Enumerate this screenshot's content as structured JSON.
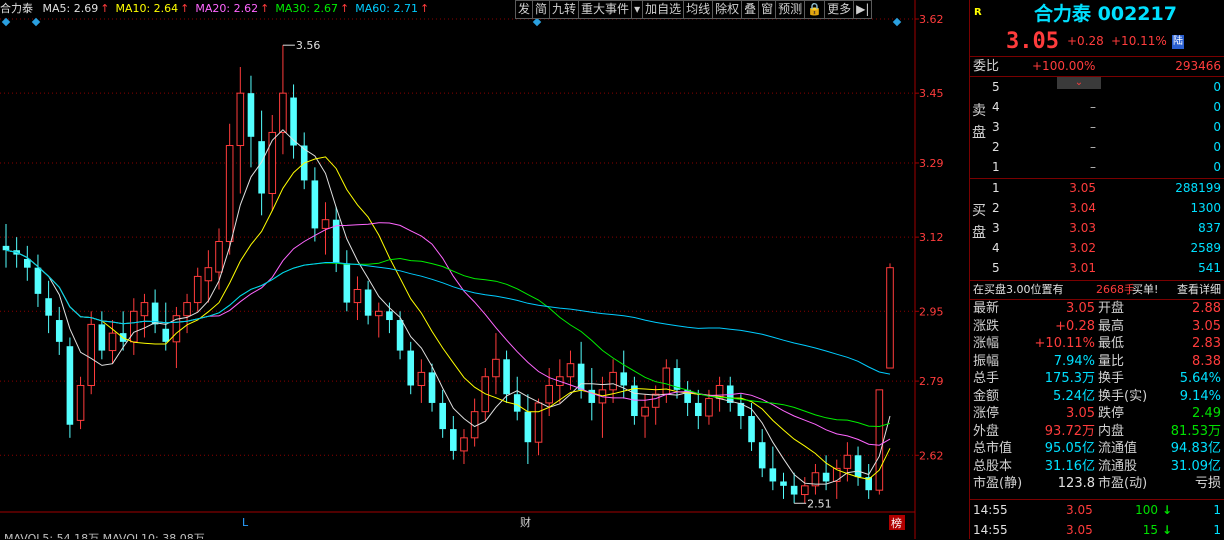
{
  "chart_title": "合力泰",
  "ma_legend": [
    {
      "label": "MA5: 2.69",
      "arrow": "↑",
      "color": "#e0e0e0"
    },
    {
      "label": "MA10: 2.64",
      "arrow": "↑",
      "color": "#ffff00"
    },
    {
      "label": "MA20: 2.62",
      "arrow": "↑",
      "color": "#ff66ff"
    },
    {
      "label": "MA30: 2.67",
      "arrow": "↑",
      "color": "#00ee00"
    },
    {
      "label": "MA60: 2.71",
      "arrow": "↑",
      "color": "#00ccff"
    }
  ],
  "toolbar": [
    "发",
    "简",
    "九转",
    "重大事件",
    "▾",
    "加自选",
    "均线",
    "除权",
    "叠",
    "窗",
    "预测",
    "🔒",
    "更多",
    "▶|"
  ],
  "bottom_markers": {
    "l": "L",
    "cai": "财",
    "bang": "榜"
  },
  "bottom_strip": "MAVOL5: 54.18万   MAVOL10: 38.08万",
  "chart_data": {
    "type": "candlestick",
    "y_ticks": [
      "3.62",
      "3.45",
      "3.29",
      "3.12",
      "2.95",
      "2.79",
      "2.62"
    ],
    "y_range": [
      2.49,
      3.62
    ],
    "annotations": {
      "high": "3.56",
      "low": "2.51"
    },
    "candles": [
      [
        3.1,
        3.15,
        3.05,
        3.09
      ],
      [
        3.09,
        3.12,
        3.05,
        3.08
      ],
      [
        3.07,
        3.1,
        3.02,
        3.05
      ],
      [
        3.05,
        3.08,
        2.96,
        2.99
      ],
      [
        2.98,
        3.02,
        2.9,
        2.94
      ],
      [
        2.93,
        2.96,
        2.85,
        2.88
      ],
      [
        2.87,
        2.89,
        2.66,
        2.69
      ],
      [
        2.7,
        2.8,
        2.68,
        2.78
      ],
      [
        2.78,
        2.95,
        2.76,
        2.92
      ],
      [
        2.92,
        2.95,
        2.84,
        2.86
      ],
      [
        2.86,
        2.93,
        2.83,
        2.9
      ],
      [
        2.9,
        2.95,
        2.86,
        2.88
      ],
      [
        2.88,
        2.98,
        2.85,
        2.95
      ],
      [
        2.94,
        2.99,
        2.89,
        2.97
      ],
      [
        2.97,
        3.0,
        2.9,
        2.92
      ],
      [
        2.91,
        2.97,
        2.86,
        2.88
      ],
      [
        2.88,
        2.96,
        2.82,
        2.94
      ],
      [
        2.94,
        2.99,
        2.9,
        2.97
      ],
      [
        2.97,
        3.05,
        2.95,
        3.03
      ],
      [
        3.02,
        3.09,
        2.97,
        3.05
      ],
      [
        3.04,
        3.14,
        3.0,
        3.11
      ],
      [
        3.11,
        3.38,
        3.08,
        3.33
      ],
      [
        3.33,
        3.51,
        3.22,
        3.45
      ],
      [
        3.45,
        3.49,
        3.28,
        3.35
      ],
      [
        3.34,
        3.41,
        3.17,
        3.22
      ],
      [
        3.22,
        3.4,
        3.18,
        3.36
      ],
      [
        3.36,
        3.56,
        3.31,
        3.45
      ],
      [
        3.44,
        3.47,
        3.3,
        3.33
      ],
      [
        3.33,
        3.36,
        3.23,
        3.25
      ],
      [
        3.25,
        3.28,
        3.11,
        3.14
      ],
      [
        3.14,
        3.2,
        3.08,
        3.16
      ],
      [
        3.16,
        3.19,
        3.04,
        3.06
      ],
      [
        3.06,
        3.09,
        2.95,
        2.97
      ],
      [
        2.97,
        3.03,
        2.93,
        3.0
      ],
      [
        3.0,
        3.02,
        2.92,
        2.94
      ],
      [
        2.94,
        2.97,
        2.89,
        2.95
      ],
      [
        2.95,
        2.97,
        2.9,
        2.93
      ],
      [
        2.93,
        2.95,
        2.84,
        2.86
      ],
      [
        2.86,
        2.88,
        2.76,
        2.78
      ],
      [
        2.78,
        2.84,
        2.74,
        2.81
      ],
      [
        2.81,
        2.83,
        2.72,
        2.74
      ],
      [
        2.74,
        2.77,
        2.66,
        2.68
      ],
      [
        2.68,
        2.71,
        2.61,
        2.63
      ],
      [
        2.63,
        2.68,
        2.6,
        2.66
      ],
      [
        2.66,
        2.75,
        2.64,
        2.72
      ],
      [
        2.72,
        2.82,
        2.7,
        2.8
      ],
      [
        2.8,
        2.9,
        2.76,
        2.84
      ],
      [
        2.84,
        2.86,
        2.74,
        2.76
      ],
      [
        2.76,
        2.8,
        2.7,
        2.72
      ],
      [
        2.72,
        2.76,
        2.6,
        2.65
      ],
      [
        2.65,
        2.75,
        2.62,
        2.74
      ],
      [
        2.74,
        2.82,
        2.71,
        2.78
      ],
      [
        2.78,
        2.84,
        2.74,
        2.8
      ],
      [
        2.8,
        2.86,
        2.77,
        2.83
      ],
      [
        2.83,
        2.88,
        2.75,
        2.77
      ],
      [
        2.77,
        2.82,
        2.7,
        2.74
      ],
      [
        2.74,
        2.8,
        2.66,
        2.77
      ],
      [
        2.77,
        2.84,
        2.74,
        2.81
      ],
      [
        2.81,
        2.86,
        2.75,
        2.78
      ],
      [
        2.78,
        2.8,
        2.69,
        2.71
      ],
      [
        2.71,
        2.76,
        2.66,
        2.73
      ],
      [
        2.73,
        2.78,
        2.69,
        2.76
      ],
      [
        2.76,
        2.84,
        2.74,
        2.82
      ],
      [
        2.82,
        2.84,
        2.75,
        2.77
      ],
      [
        2.77,
        2.79,
        2.71,
        2.74
      ],
      [
        2.74,
        2.77,
        2.68,
        2.71
      ],
      [
        2.71,
        2.77,
        2.69,
        2.75
      ],
      [
        2.75,
        2.8,
        2.72,
        2.78
      ],
      [
        2.78,
        2.8,
        2.72,
        2.74
      ],
      [
        2.74,
        2.76,
        2.68,
        2.71
      ],
      [
        2.71,
        2.74,
        2.63,
        2.65
      ],
      [
        2.65,
        2.68,
        2.57,
        2.59
      ],
      [
        2.59,
        2.64,
        2.54,
        2.56
      ],
      [
        2.56,
        2.58,
        2.52,
        2.55
      ],
      [
        2.55,
        2.58,
        2.51,
        2.53
      ],
      [
        2.53,
        2.57,
        2.51,
        2.55
      ],
      [
        2.55,
        2.6,
        2.53,
        2.58
      ],
      [
        2.58,
        2.62,
        2.54,
        2.56
      ],
      [
        2.56,
        2.61,
        2.52,
        2.59
      ],
      [
        2.59,
        2.65,
        2.56,
        2.62
      ],
      [
        2.62,
        2.64,
        2.55,
        2.57
      ],
      [
        2.57,
        2.6,
        2.52,
        2.54
      ],
      [
        2.54,
        2.77,
        2.53,
        2.77
      ],
      [
        2.82,
        3.06,
        2.82,
        3.05
      ]
    ],
    "ma_series": [
      {
        "name": "MA5",
        "color": "#e0e0e0"
      },
      {
        "name": "MA10",
        "color": "#ffff00"
      },
      {
        "name": "MA20",
        "color": "#ff66ff"
      },
      {
        "name": "MA30",
        "color": "#00ee00"
      },
      {
        "name": "MA60",
        "color": "#00ccff"
      }
    ]
  },
  "quote": {
    "r_mark": "R",
    "name": "合力泰",
    "code": "002217",
    "price": "3.05",
    "change": "+0.28",
    "pct": "+10.11%",
    "lu": "陆",
    "weibi_label": "委比",
    "weibi_val": "+100.00%",
    "weicha_val": "293466",
    "sell_label": [
      "卖",
      "盘"
    ],
    "buy_label": [
      "买",
      "盘"
    ],
    "sells": [
      {
        "lvl": "5",
        "price": "–",
        "vol": "0"
      },
      {
        "lvl": "4",
        "price": "–",
        "vol": "0"
      },
      {
        "lvl": "3",
        "price": "–",
        "vol": "0"
      },
      {
        "lvl": "2",
        "price": "–",
        "vol": "0"
      },
      {
        "lvl": "1",
        "price": "–",
        "vol": "0"
      }
    ],
    "buys": [
      {
        "lvl": "1",
        "price": "3.05",
        "vol": "288199"
      },
      {
        "lvl": "2",
        "price": "3.04",
        "vol": "1300"
      },
      {
        "lvl": "3",
        "price": "3.03",
        "vol": "837"
      },
      {
        "lvl": "4",
        "price": "3.02",
        "vol": "2589"
      },
      {
        "lvl": "5",
        "price": "3.01",
        "vol": "541"
      }
    ],
    "queue_note": "在买盘3.00位置有",
    "queue_qty": "2668手",
    "queue_tag": "买单!",
    "queue_link": "查看详细",
    "stats": [
      {
        "l1": "最新",
        "v1": "3.05",
        "c1": "red",
        "l2": "开盘",
        "v2": "2.88",
        "c2": "red"
      },
      {
        "l1": "涨跌",
        "v1": "+0.28",
        "c1": "red",
        "l2": "最高",
        "v2": "3.05",
        "c2": "red"
      },
      {
        "l1": "涨幅",
        "v1": "+10.11%",
        "c1": "red",
        "l2": "最低",
        "v2": "2.83",
        "c2": "red"
      },
      {
        "l1": "振幅",
        "v1": "7.94%",
        "c1": "cyan",
        "l2": "量比",
        "v2": "8.38",
        "c2": "red"
      },
      {
        "l1": "总手",
        "v1": "175.3万",
        "c1": "cyan",
        "l2": "换手",
        "v2": "5.64%",
        "c2": "cyan"
      },
      {
        "l1": "金额",
        "v1": "5.24亿",
        "c1": "cyan",
        "l2": "换手(实)",
        "v2": "9.14%",
        "c2": "cyan"
      },
      {
        "l1": "涨停",
        "v1": "3.05",
        "c1": "red",
        "l2": "跌停",
        "v2": "2.49",
        "c2": "green"
      },
      {
        "l1": "外盘",
        "v1": "93.72万",
        "c1": "red",
        "l2": "内盘",
        "v2": "81.53万",
        "c2": "green"
      },
      {
        "l1": "总市值",
        "v1": "95.05亿",
        "c1": "cyan",
        "l2": "流通值",
        "v2": "94.83亿",
        "c2": "cyan"
      },
      {
        "l1": "总股本",
        "v1": "31.16亿",
        "c1": "cyan",
        "l2": "流通股",
        "v2": "31.09亿",
        "c2": "cyan"
      },
      {
        "l1": "市盈(静)",
        "v1": "123.8",
        "c1": "white",
        "l2": "市盈(动)",
        "v2": "亏损",
        "c2": "white"
      }
    ],
    "ticks": [
      {
        "time": "14:55",
        "price": "3.05",
        "vol": "100",
        "arrow": "↓",
        "n": "1"
      },
      {
        "time": "14:55",
        "price": "3.05",
        "vol": "15",
        "arrow": "↓",
        "n": "1"
      }
    ]
  }
}
